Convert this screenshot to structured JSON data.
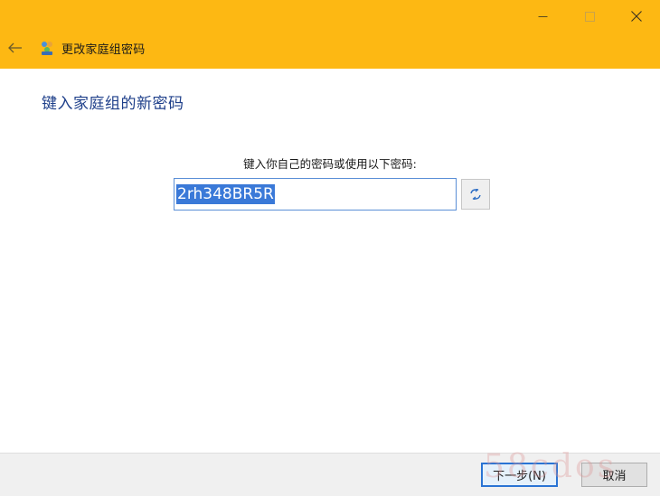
{
  "window": {
    "title": "更改家庭组密码",
    "accent_color": "#fdb813",
    "controls": {
      "minimize_icon": "minimize-icon",
      "maximize_icon": "maximize-icon",
      "close_icon": "close-icon"
    },
    "back_icon": "back-arrow-icon",
    "app_icon": "homegroup-icon"
  },
  "main": {
    "heading": "键入家庭组的新密码",
    "prompt": "键入你自己的密码或使用以下密码:",
    "password_value": "2rh348BR5R",
    "refresh_icon": "refresh-password-icon"
  },
  "footer": {
    "next_label": "下一步(N)",
    "cancel_label": "取消"
  },
  "watermark": {
    "text": "58cdos"
  }
}
